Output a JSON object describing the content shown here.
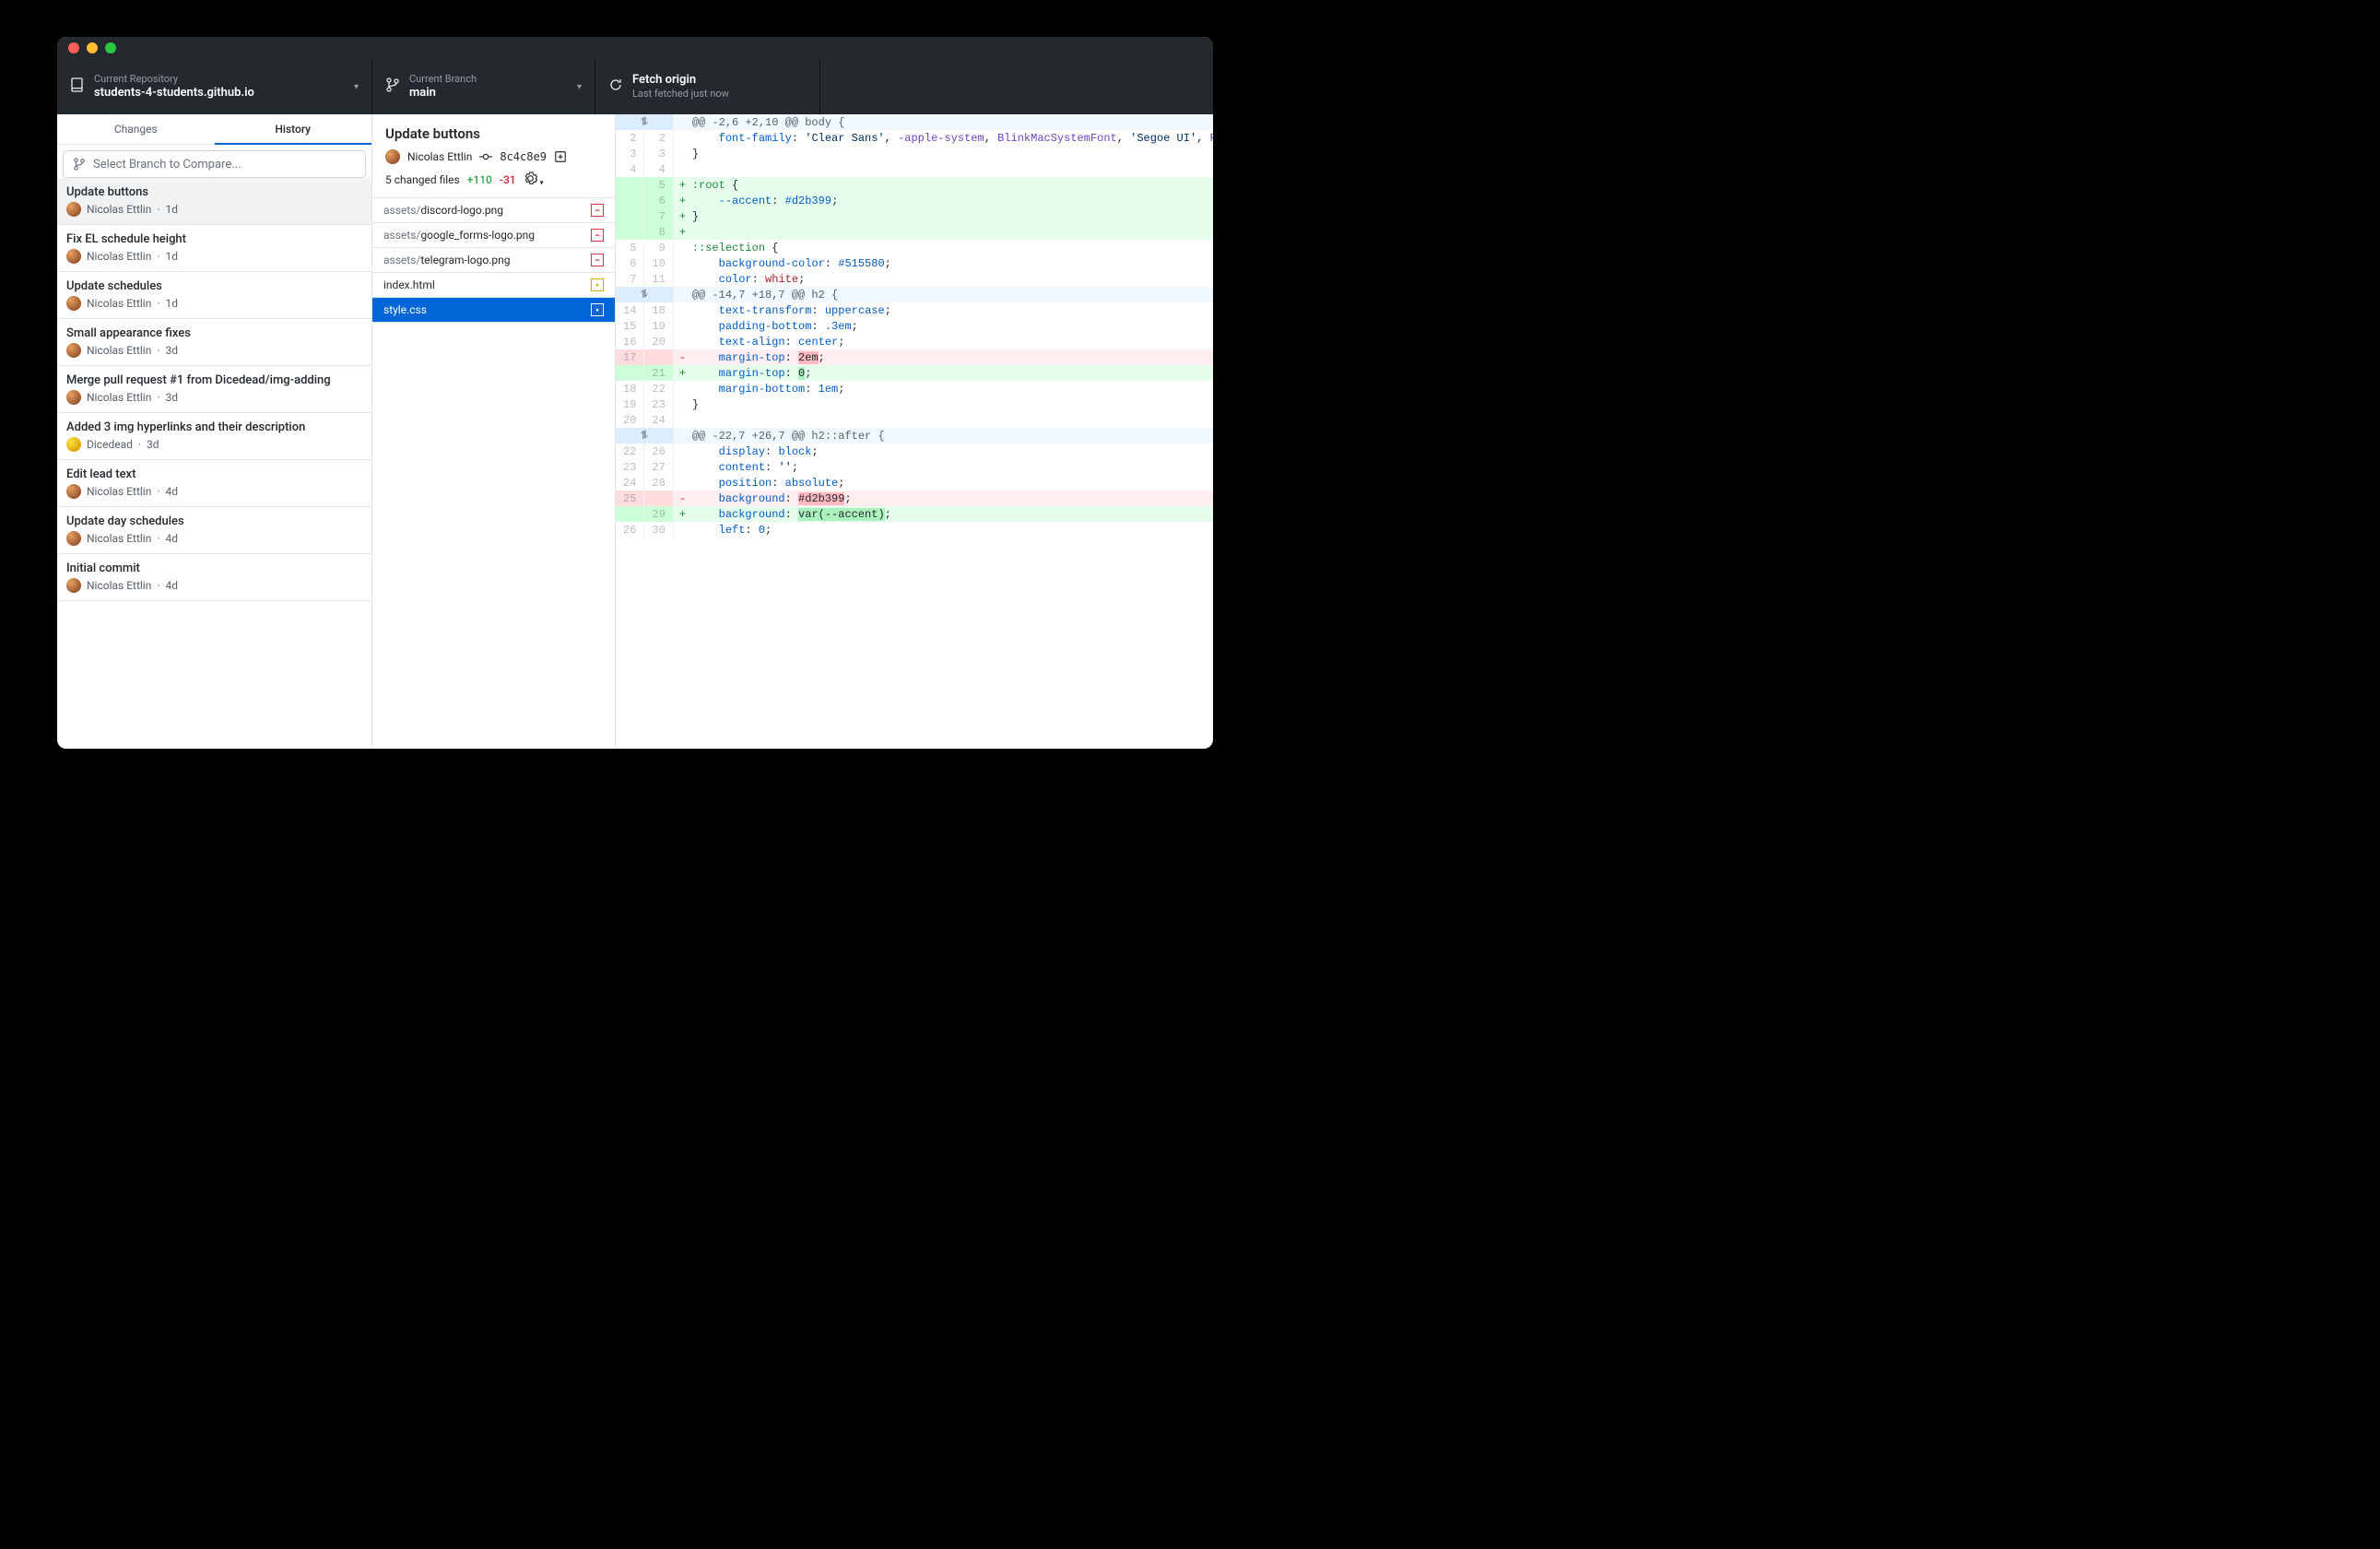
{
  "toolbar": {
    "repo_label": "Current Repository",
    "repo_name": "students-4-students.github.io",
    "branch_label": "Current Branch",
    "branch_name": "main",
    "fetch_label": "Fetch origin",
    "fetch_sub": "Last fetched just now"
  },
  "tabs": {
    "changes": "Changes",
    "history": "History"
  },
  "branch_select_placeholder": "Select Branch to Compare...",
  "commits": [
    {
      "title": "Update buttons",
      "author": "Nicolas Ettlin",
      "time": "1d",
      "selected": true
    },
    {
      "title": "Fix EL schedule height",
      "author": "Nicolas Ettlin",
      "time": "1d"
    },
    {
      "title": "Update schedules",
      "author": "Nicolas Ettlin",
      "time": "1d"
    },
    {
      "title": "Small appearance fixes",
      "author": "Nicolas Ettlin",
      "time": "3d"
    },
    {
      "title": "Merge pull request #1 from Dicedead/img-adding",
      "author": "Nicolas Ettlin",
      "time": "3d"
    },
    {
      "title": "Added 3 img hyperlinks and their description",
      "author": "Dicedead",
      "time": "3d",
      "alt": true
    },
    {
      "title": "Edit lead text",
      "author": "Nicolas Ettlin",
      "time": "4d"
    },
    {
      "title": "Update day schedules",
      "author": "Nicolas Ettlin",
      "time": "4d"
    },
    {
      "title": "Initial commit",
      "author": "Nicolas Ettlin",
      "time": "4d"
    }
  ],
  "detail": {
    "title": "Update buttons",
    "author": "Nicolas Ettlin",
    "sha": "8c4c8e9",
    "changed_files": "5 changed files",
    "added": "+110",
    "removed": "-31"
  },
  "files": [
    {
      "dir": "assets/",
      "name": "discord-logo.png",
      "status": "deleted"
    },
    {
      "dir": "assets/",
      "name": "google_forms-logo.png",
      "status": "deleted"
    },
    {
      "dir": "assets/",
      "name": "telegram-logo.png",
      "status": "deleted"
    },
    {
      "dir": "",
      "name": "index.html",
      "status": "modified"
    },
    {
      "dir": "",
      "name": "style.css",
      "status": "modified",
      "selected": true
    }
  ],
  "diff": [
    {
      "type": "hunk",
      "text": "@@ -2,6 +2,10 @@ body {"
    },
    {
      "type": "ctx",
      "old": "2",
      "new": "2",
      "html": "    <span class='tok-prop'>font-family</span>: <span class='tok-str'>'Clear Sans'</span>, <span class='tok-sys'>-apple-system</span>, <span class='tok-sys'>BlinkMacSystemFont</span>, <span class='tok-str'>'Segoe UI'</span>, <span class='tok-sys'>Roboto</span>, <span class='tok-sys'>Oxygen</span>, <span class='tok-sys'>Ubuntu</span>, <span class='tok-sys'>Cantarell</span>, <span class='tok-str'>'Open Sans'</span>, <span class='tok-str'>'Helvetica Neue'</span>, <span class='tok-sys'>sans-serif</span>;"
    },
    {
      "type": "ctx",
      "old": "3",
      "new": "3",
      "html": "}"
    },
    {
      "type": "ctx",
      "old": "4",
      "new": "4",
      "html": ""
    },
    {
      "type": "add",
      "old": "",
      "new": "5",
      "html": "<span class='tok-sel'>:root</span> {"
    },
    {
      "type": "add",
      "old": "",
      "new": "6",
      "html": "    <span class='tok-prop'>--accent</span>: <span class='tok-val'>#d2b399</span>;"
    },
    {
      "type": "add",
      "old": "",
      "new": "7",
      "html": "}"
    },
    {
      "type": "add",
      "old": "",
      "new": "8",
      "html": ""
    },
    {
      "type": "ctx",
      "old": "5",
      "new": "9",
      "html": "<span class='tok-sel'>::selection</span> {"
    },
    {
      "type": "ctx",
      "old": "6",
      "new": "10",
      "html": "    <span class='tok-prop'>background-color</span>: <span class='tok-val'>#515580</span>;"
    },
    {
      "type": "ctx",
      "old": "7",
      "new": "11",
      "html": "    <span class='tok-prop'>color</span>: <span class='tok-red'>white</span>;"
    },
    {
      "type": "hunk",
      "text": "@@ -14,7 +18,7 @@ h2 {"
    },
    {
      "type": "ctx",
      "old": "14",
      "new": "18",
      "html": "    <span class='tok-prop'>text-transform</span>: <span class='tok-val'>uppercase</span>;"
    },
    {
      "type": "ctx",
      "old": "15",
      "new": "19",
      "html": "    <span class='tok-prop'>padding-bottom</span>: <span class='tok-num'>.3em</span>;"
    },
    {
      "type": "ctx",
      "old": "16",
      "new": "20",
      "html": "    <span class='tok-prop'>text-align</span>: <span class='tok-val'>center</span>;"
    },
    {
      "type": "del",
      "old": "17",
      "new": "",
      "html": "    <span class='tok-prop'>margin-top</span>: <span class='highlight-del'>2em</span>;"
    },
    {
      "type": "add",
      "old": "",
      "new": "21",
      "html": "    <span class='tok-prop'>margin-top</span>: <span class='highlight-add'>0</span>;"
    },
    {
      "type": "ctx",
      "old": "18",
      "new": "22",
      "html": "    <span class='tok-prop'>margin-bottom</span>: <span class='tok-num'>1em</span>;"
    },
    {
      "type": "ctx",
      "old": "19",
      "new": "23",
      "html": "}"
    },
    {
      "type": "ctx",
      "old": "20",
      "new": "24",
      "html": ""
    },
    {
      "type": "hunk",
      "text": "@@ -22,7 +26,7 @@ h2::after {"
    },
    {
      "type": "ctx",
      "old": "22",
      "new": "26",
      "html": "    <span class='tok-prop'>display</span>: <span class='tok-val'>block</span>;"
    },
    {
      "type": "ctx",
      "old": "23",
      "new": "27",
      "html": "    <span class='tok-prop'>content</span>: <span class='tok-str'>''</span>;"
    },
    {
      "type": "ctx",
      "old": "24",
      "new": "28",
      "html": "    <span class='tok-prop'>position</span>: <span class='tok-val'>absolute</span>;"
    },
    {
      "type": "del",
      "old": "25",
      "new": "",
      "html": "    <span class='tok-prop'>background</span>: <span class='highlight-del'>#d2b399</span>;"
    },
    {
      "type": "add",
      "old": "",
      "new": "29",
      "html": "    <span class='tok-prop'>background</span>: <span class='highlight-add'>var(--accent)</span>;"
    },
    {
      "type": "ctx",
      "old": "26",
      "new": "30",
      "html": "    <span class='tok-prop'>left</span>: <span class='tok-num'>0</span>;"
    }
  ]
}
